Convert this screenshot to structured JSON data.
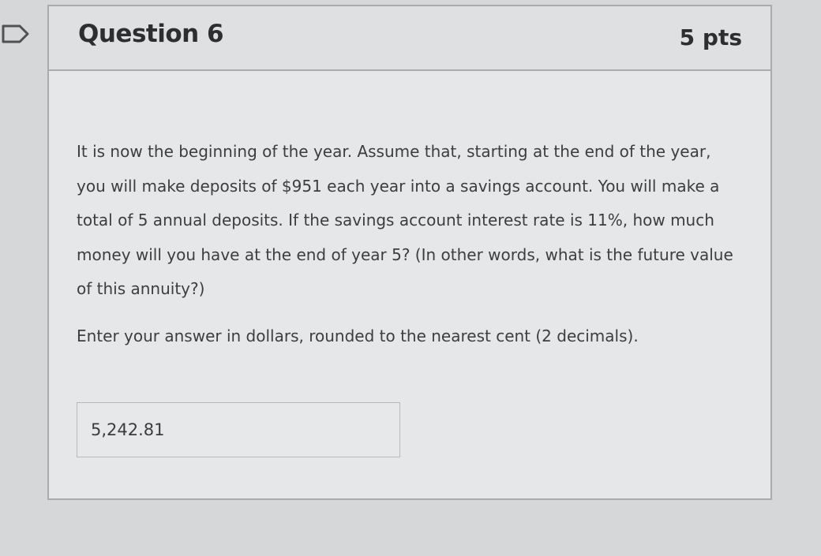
{
  "question": {
    "title": "Question 6",
    "points": "5 pts",
    "body": "It is now the beginning of the year. Assume that, starting at the end of the year, you will make deposits of $951 each year into a savings account. You will make a total of 5 annual deposits. If the savings account interest rate is 11%, how much money will you have at the end of year 5? (In other words, what is the future value of this annuity?)",
    "instructions": "Enter your answer in dollars, rounded to the nearest cent (2 decimals).",
    "answer_value": "5,242.81"
  },
  "icons": {
    "flag": "bookmark-flag-icon"
  },
  "colors": {
    "background": "#d6d7d8",
    "card": "#e6e7e8",
    "text": "#3a3d3f"
  }
}
